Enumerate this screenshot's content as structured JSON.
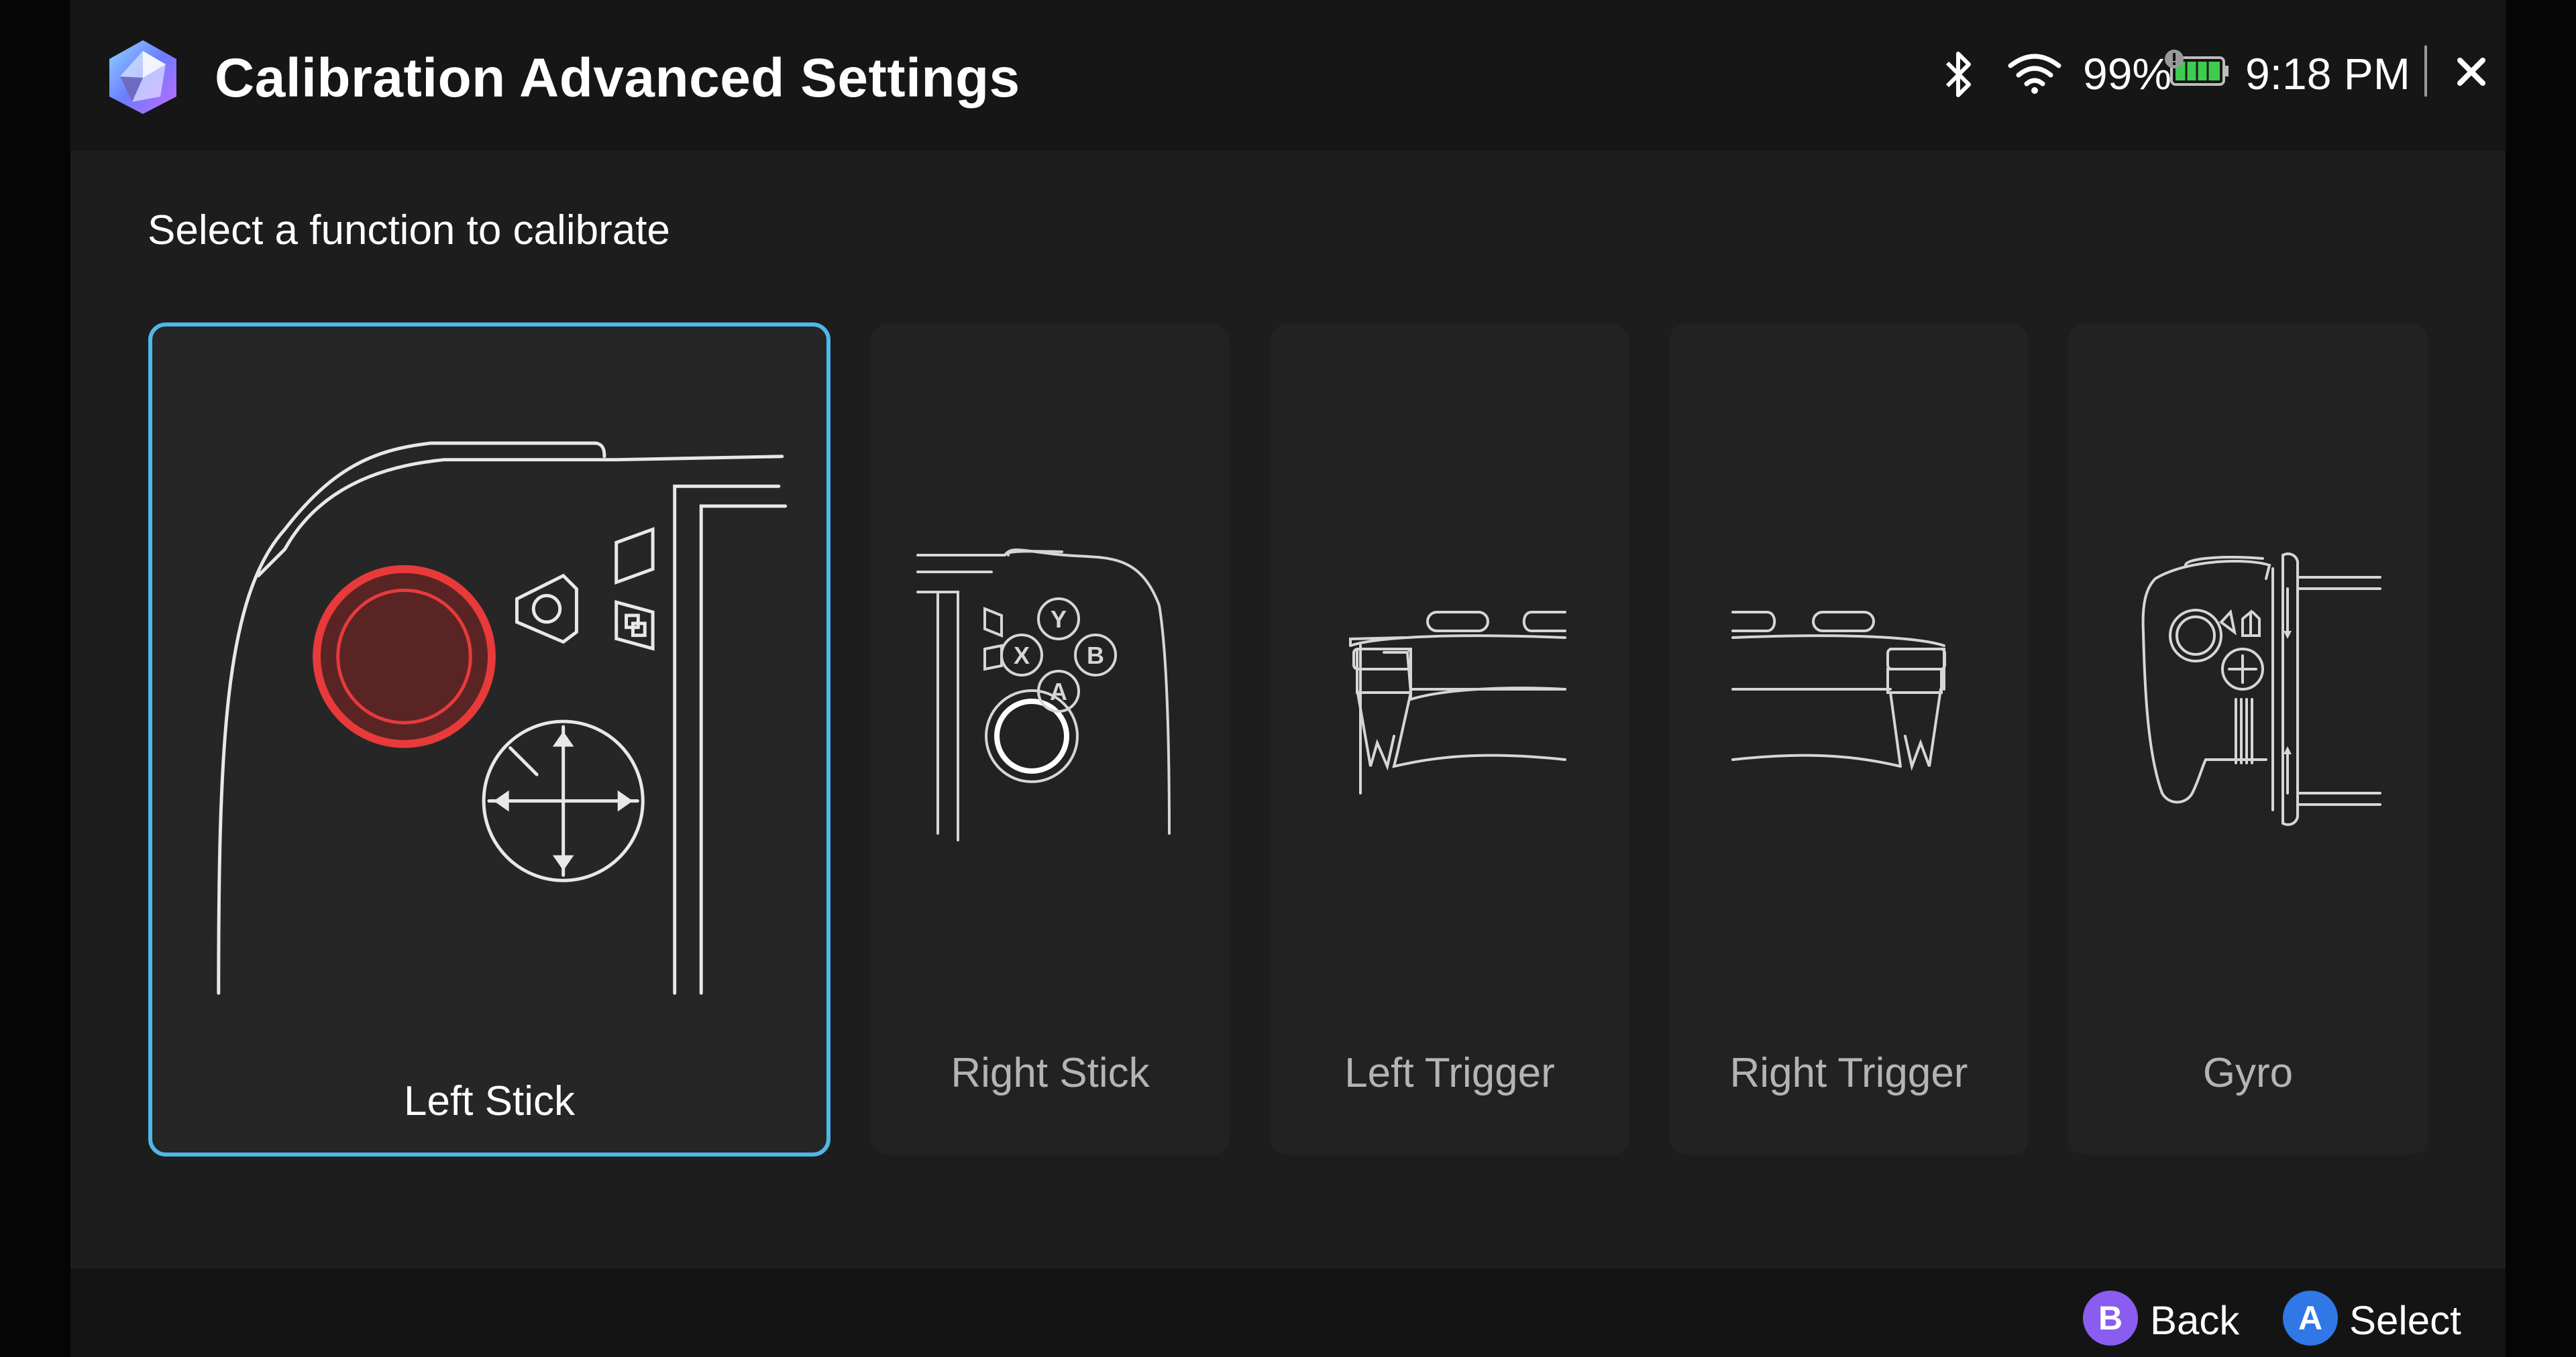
{
  "header": {
    "title": "Calibration Advanced Settings",
    "battery_percent": "99%",
    "time": "9:18 PM",
    "icons": [
      "app-logo-icon",
      "bluetooth-icon",
      "wifi-icon",
      "battery-icon",
      "close-icon"
    ]
  },
  "main": {
    "subtitle": "Select a function to calibrate",
    "cards": [
      {
        "label": "Left Stick",
        "selected": true
      },
      {
        "label": "Right Stick",
        "selected": false
      },
      {
        "label": "Left Trigger",
        "selected": false
      },
      {
        "label": "Right Trigger",
        "selected": false
      },
      {
        "label": "Gyro",
        "selected": false
      }
    ]
  },
  "footer": {
    "back": {
      "button": "B",
      "label": "Back"
    },
    "select": {
      "button": "A",
      "label": "Select"
    }
  },
  "colors": {
    "selection_border": "#4fb8e8",
    "highlight_red": "#e83a3a",
    "back_button": "#8a5cf0",
    "select_button": "#2f78e6",
    "battery_green": "#3ecb4f"
  }
}
